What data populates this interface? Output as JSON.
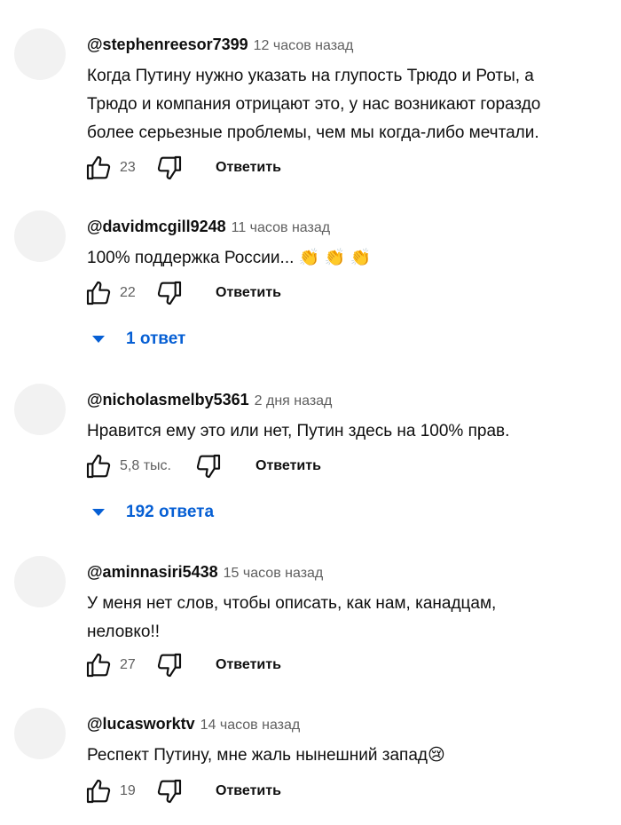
{
  "comments": [
    {
      "author": "@stephenreesor7399",
      "time": "12 часов назад",
      "text_lines": [
        "Когда Путину нужно указать на глупость Трюдо и Роты, а",
        "Трюдо и компания отрицают это, у нас возникают гораздо",
        "более серьезные проблемы, чем мы когда-либо мечтали."
      ],
      "likes": "23",
      "reply_label": "Ответить"
    },
    {
      "author": "@davidmcgill9248",
      "time": "11 часов назад",
      "text_lines": [
        "100% поддержка России... 👏 👏 👏"
      ],
      "likes": "22",
      "reply_label": "Ответить",
      "replies": "1 ответ"
    },
    {
      "author": "@nicholasmelby5361",
      "time": "2 дня назад",
      "text_lines": [
        "Нравится ему это или нет, Путин здесь на 100% прав."
      ],
      "likes": "5,8 тыс.",
      "reply_label": "Ответить",
      "replies": "192 ответа"
    },
    {
      "author": "@aminnasiri5438",
      "time": "15 часов назад",
      "text_lines": [
        "У меня нет слов, чтобы описать, как нам, канадцам,",
        "неловко!!"
      ],
      "likes": "27",
      "reply_label": "Ответить"
    },
    {
      "author": "@lucasworktv",
      "time": "14 часов назад",
      "text_lines": [
        "Респект Путину, мне жаль нынешний запад😢"
      ],
      "likes": "19",
      "reply_label": "Ответить"
    }
  ]
}
